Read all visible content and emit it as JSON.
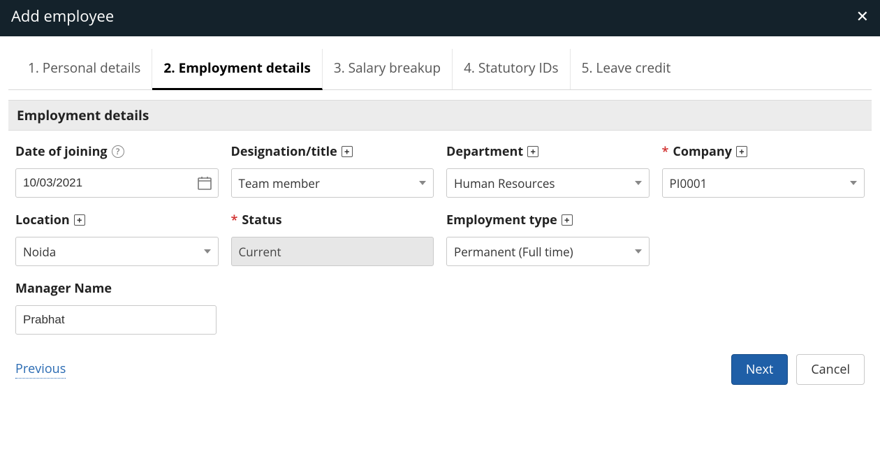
{
  "header": {
    "title": "Add employee"
  },
  "tabs": [
    {
      "label": "1. Personal details"
    },
    {
      "label": "2. Employment details"
    },
    {
      "label": "3. Salary breakup"
    },
    {
      "label": "4. Statutory IDs"
    },
    {
      "label": "5. Leave credit"
    }
  ],
  "section": {
    "title": "Employment details"
  },
  "fields": {
    "date_of_joining": {
      "label": "Date of joining",
      "value": "10/03/2021"
    },
    "designation": {
      "label": "Designation/title",
      "value": "Team member"
    },
    "department": {
      "label": "Department",
      "value": "Human Resources"
    },
    "company": {
      "label": "Company",
      "value": "PI0001",
      "required": true
    },
    "location": {
      "label": "Location",
      "value": "Noida"
    },
    "status": {
      "label": "Status",
      "value": "Current",
      "required": true
    },
    "employment_type": {
      "label": "Employment type",
      "value": "Permanent (Full time)"
    },
    "manager": {
      "label": "Manager Name",
      "value": "Prabhat"
    }
  },
  "footer": {
    "previous": "Previous",
    "next": "Next",
    "cancel": "Cancel"
  }
}
